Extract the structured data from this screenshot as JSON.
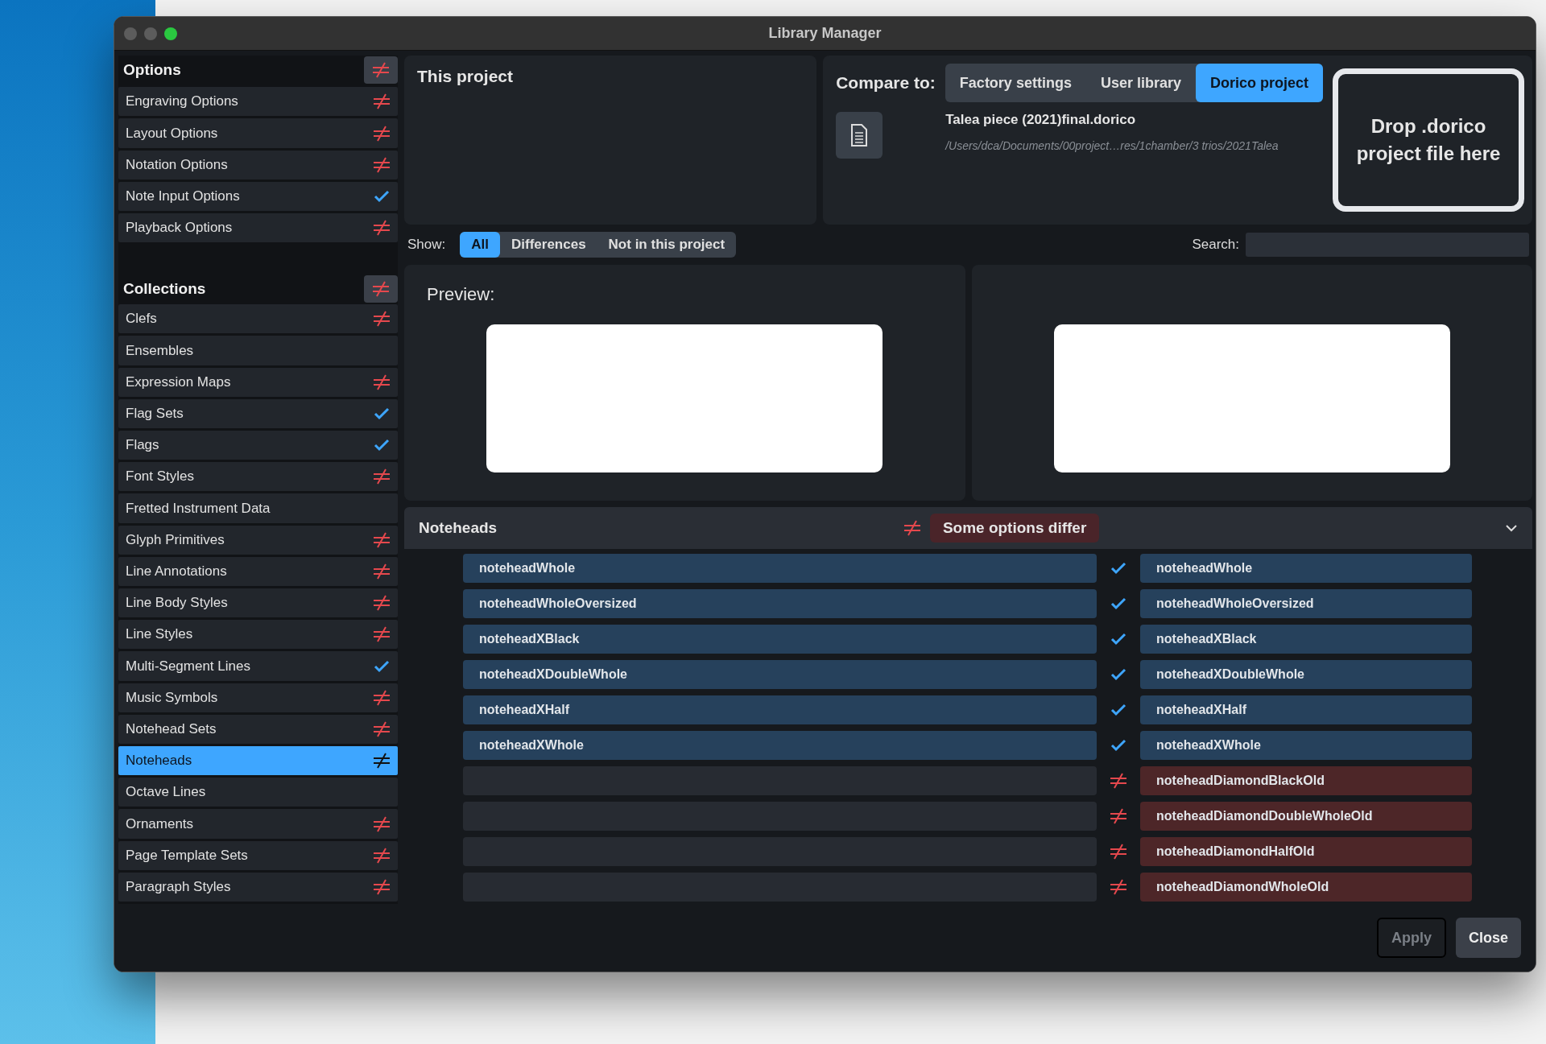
{
  "window": {
    "title": "Library Manager",
    "controls": [
      {
        "active": false
      },
      {
        "active": false
      },
      {
        "active": true
      }
    ]
  },
  "sidebar": {
    "sections": [
      {
        "title": "Options",
        "kind": "differ",
        "items": [
          {
            "label": "Engraving Options",
            "kind": "differ",
            "selected": false
          },
          {
            "label": "Layout Options",
            "kind": "differ",
            "selected": false
          },
          {
            "label": "Notation Options",
            "kind": "differ",
            "selected": false
          },
          {
            "label": "Note Input Options",
            "kind": "same",
            "selected": false
          },
          {
            "label": "Playback Options",
            "kind": "differ",
            "selected": false
          }
        ]
      },
      {
        "title": "Collections",
        "kind": "differ",
        "items": [
          {
            "label": "Clefs",
            "kind": "differ",
            "selected": false
          },
          {
            "label": "Ensembles",
            "kind": "none",
            "selected": false
          },
          {
            "label": "Expression Maps",
            "kind": "differ",
            "selected": false
          },
          {
            "label": "Flag Sets",
            "kind": "same",
            "selected": false
          },
          {
            "label": "Flags",
            "kind": "same",
            "selected": false
          },
          {
            "label": "Font Styles",
            "kind": "differ",
            "selected": false
          },
          {
            "label": "Fretted Instrument Data",
            "kind": "none",
            "selected": false
          },
          {
            "label": "Glyph Primitives",
            "kind": "differ",
            "selected": false
          },
          {
            "label": "Line Annotations",
            "kind": "differ",
            "selected": false
          },
          {
            "label": "Line Body Styles",
            "kind": "differ",
            "selected": false
          },
          {
            "label": "Line Styles",
            "kind": "differ",
            "selected": false
          },
          {
            "label": "Multi-Segment Lines",
            "kind": "same",
            "selected": false
          },
          {
            "label": "Music Symbols",
            "kind": "differ",
            "selected": false
          },
          {
            "label": "Notehead Sets",
            "kind": "differ",
            "selected": false
          },
          {
            "label": "Noteheads",
            "kind": "differ",
            "selected": true
          },
          {
            "label": "Octave Lines",
            "kind": "none",
            "selected": false
          },
          {
            "label": "Ornaments",
            "kind": "differ",
            "selected": false
          },
          {
            "label": "Page Template Sets",
            "kind": "differ",
            "selected": false
          },
          {
            "label": "Paragraph Styles",
            "kind": "differ",
            "selected": false
          }
        ]
      }
    ]
  },
  "this_project": {
    "title": "This project"
  },
  "compare": {
    "label": "Compare to:",
    "options": [
      {
        "label": "Factory settings",
        "selected": false
      },
      {
        "label": "User library",
        "selected": false
      },
      {
        "label": "Dorico project",
        "selected": true
      }
    ],
    "file_name": "Talea piece (2021)final.dorico",
    "file_path": "/Users/dca/Documents/00project…res/1chamber/3 trios/2021Talea",
    "drop_zone": "Drop .dorico project file here"
  },
  "show": {
    "label": "Show:",
    "options": [
      {
        "label": "All",
        "selected": true
      },
      {
        "label": "Differences",
        "selected": false
      },
      {
        "label": "Not in this project",
        "selected": false
      }
    ]
  },
  "search": {
    "label": "Search:"
  },
  "preview": {
    "label": "Preview:"
  },
  "section": {
    "title": "Noteheads",
    "kind": "differ",
    "summary": "Some options differ",
    "expanded": true,
    "rows": [
      {
        "left": "noteheadWhole",
        "kind": "same",
        "right": "noteheadWhole"
      },
      {
        "left": "noteheadWholeOversized",
        "kind": "same",
        "right": "noteheadWholeOversized"
      },
      {
        "left": "noteheadXBlack",
        "kind": "same",
        "right": "noteheadXBlack"
      },
      {
        "left": "noteheadXDoubleWhole",
        "kind": "same",
        "right": "noteheadXDoubleWhole"
      },
      {
        "left": "noteheadXHalf",
        "kind": "same",
        "right": "noteheadXHalf"
      },
      {
        "left": "noteheadXWhole",
        "kind": "same",
        "right": "noteheadXWhole"
      },
      {
        "kind": "differ",
        "right": "noteheadDiamondBlackOld"
      },
      {
        "kind": "differ",
        "right": "noteheadDiamondDoubleWholeOld"
      },
      {
        "kind": "differ",
        "right": "noteheadDiamondHalfOld"
      },
      {
        "kind": "differ",
        "right": "noteheadDiamondWholeOld"
      }
    ]
  },
  "buttons": [
    {
      "label": "Apply",
      "disabled": true
    },
    {
      "label": "Close",
      "disabled": false
    }
  ]
}
